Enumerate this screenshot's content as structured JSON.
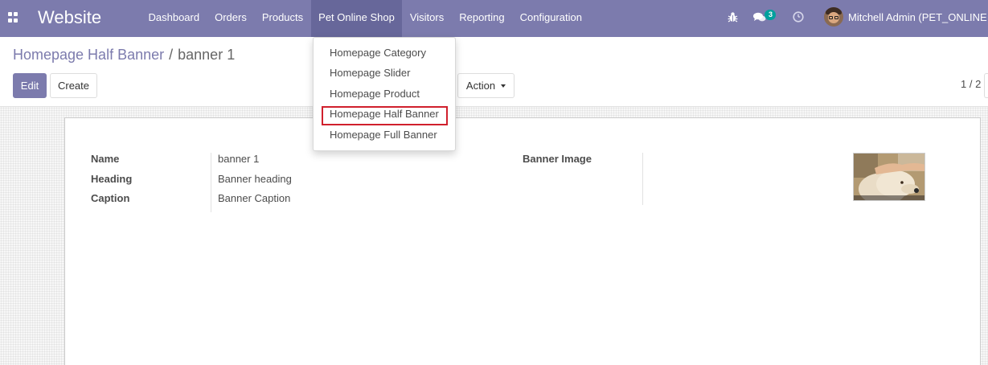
{
  "navbar": {
    "brand": "Website",
    "menu": [
      {
        "label": "Dashboard",
        "active": false
      },
      {
        "label": "Orders",
        "active": false
      },
      {
        "label": "Products",
        "active": false
      },
      {
        "label": "Pet Online Shop",
        "active": true
      },
      {
        "label": "Visitors",
        "active": false
      },
      {
        "label": "Reporting",
        "active": false
      },
      {
        "label": "Configuration",
        "active": false
      }
    ],
    "systray": {
      "debug_icon": "bug-icon",
      "messages_icon": "chat-bubbles-icon",
      "messages_count": "3",
      "activity_icon": "clock-icon",
      "user_name": "Mitchell Admin (PET_ONLINE"
    },
    "colors": {
      "navbar_bg": "#7c7bad",
      "active_menu_bg": "#67679a",
      "badge_bg": "#00a09d"
    }
  },
  "breadcrumb": {
    "parent": "Homepage Half Banner",
    "separator": "/",
    "current": "banner 1"
  },
  "toolbar": {
    "edit_label": "Edit",
    "create_label": "Create",
    "action_label": "Action",
    "pager": "1 / 2"
  },
  "dropdown": {
    "items": [
      {
        "label": "Homepage Category"
      },
      {
        "label": "Homepage Slider"
      },
      {
        "label": "Homepage Product"
      },
      {
        "label": "Homepage Half Banner",
        "highlighted": true
      },
      {
        "label": "Homepage Full Banner"
      }
    ],
    "highlight_color": "#d0202d"
  },
  "form": {
    "fields": [
      {
        "label": "Name",
        "value": "banner 1"
      },
      {
        "label": "Heading",
        "value": "Banner heading"
      },
      {
        "label": "Caption",
        "value": "Banner Caption"
      }
    ],
    "image_label": "Banner Image"
  }
}
